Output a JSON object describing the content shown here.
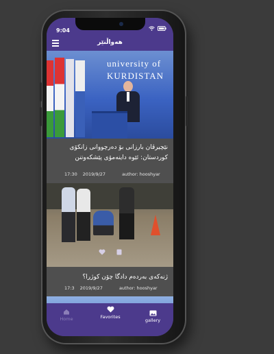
{
  "status": {
    "time": "9:04"
  },
  "appbar": {
    "title": "هەواڵنێر"
  },
  "articles": [
    {
      "headline": "نێچیرڤان بارزانی بۆ دەرچووانی زانکۆی کوردستان: ئێوە داینەمۆی پێشکەوتنن",
      "time": "17:30",
      "date": "2019/9/27",
      "author": "author: hooshyar",
      "image_text": "university of KURDISTAN"
    },
    {
      "headline": "ژنەکەی بەردەم دادگا چۆن کوژرا؟",
      "time": "17:3",
      "date": "2019/9/27",
      "author": "author: hooshyar"
    }
  ],
  "tabs": {
    "home": "Home",
    "favorites": "Favorites",
    "gallery": "gallery"
  },
  "colors": {
    "brand": "#4c3a8c",
    "card": "#4f4f4f"
  }
}
